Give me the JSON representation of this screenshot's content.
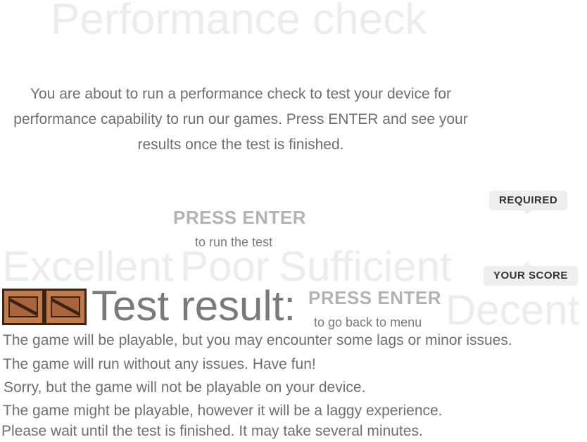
{
  "title": "Performance check",
  "intro": "You are about to run a performance check to test your device for performance capability to run our games. Press ENTER and see your results once the test is finished.",
  "start_prompt": {
    "label": "PRESS ENTER",
    "sub": "to run the test"
  },
  "tags": {
    "required": "REQUIRED",
    "your_score": "YOUR SCORE"
  },
  "score_words": {
    "excellent": "Excellent",
    "poor": "Poor",
    "sufficient": "Sufficient",
    "decent": "Decent"
  },
  "crate_icon_count": 2,
  "result_label": "Test result:",
  "back_prompt": {
    "label": "PRESS ENTER",
    "sub": "to go back to menu"
  },
  "messages": {
    "decent": "The game will be playable, but you may encounter some lags or minor issues.",
    "excellent": "The game will run without any issues. Have fun!",
    "poor": "Sorry, but the game will not be playable on your device.",
    "sufficient": "The game might be playable, however it will be a laggy experience.",
    "wait": "Please wait until the test is finished. It may take several minutes."
  }
}
